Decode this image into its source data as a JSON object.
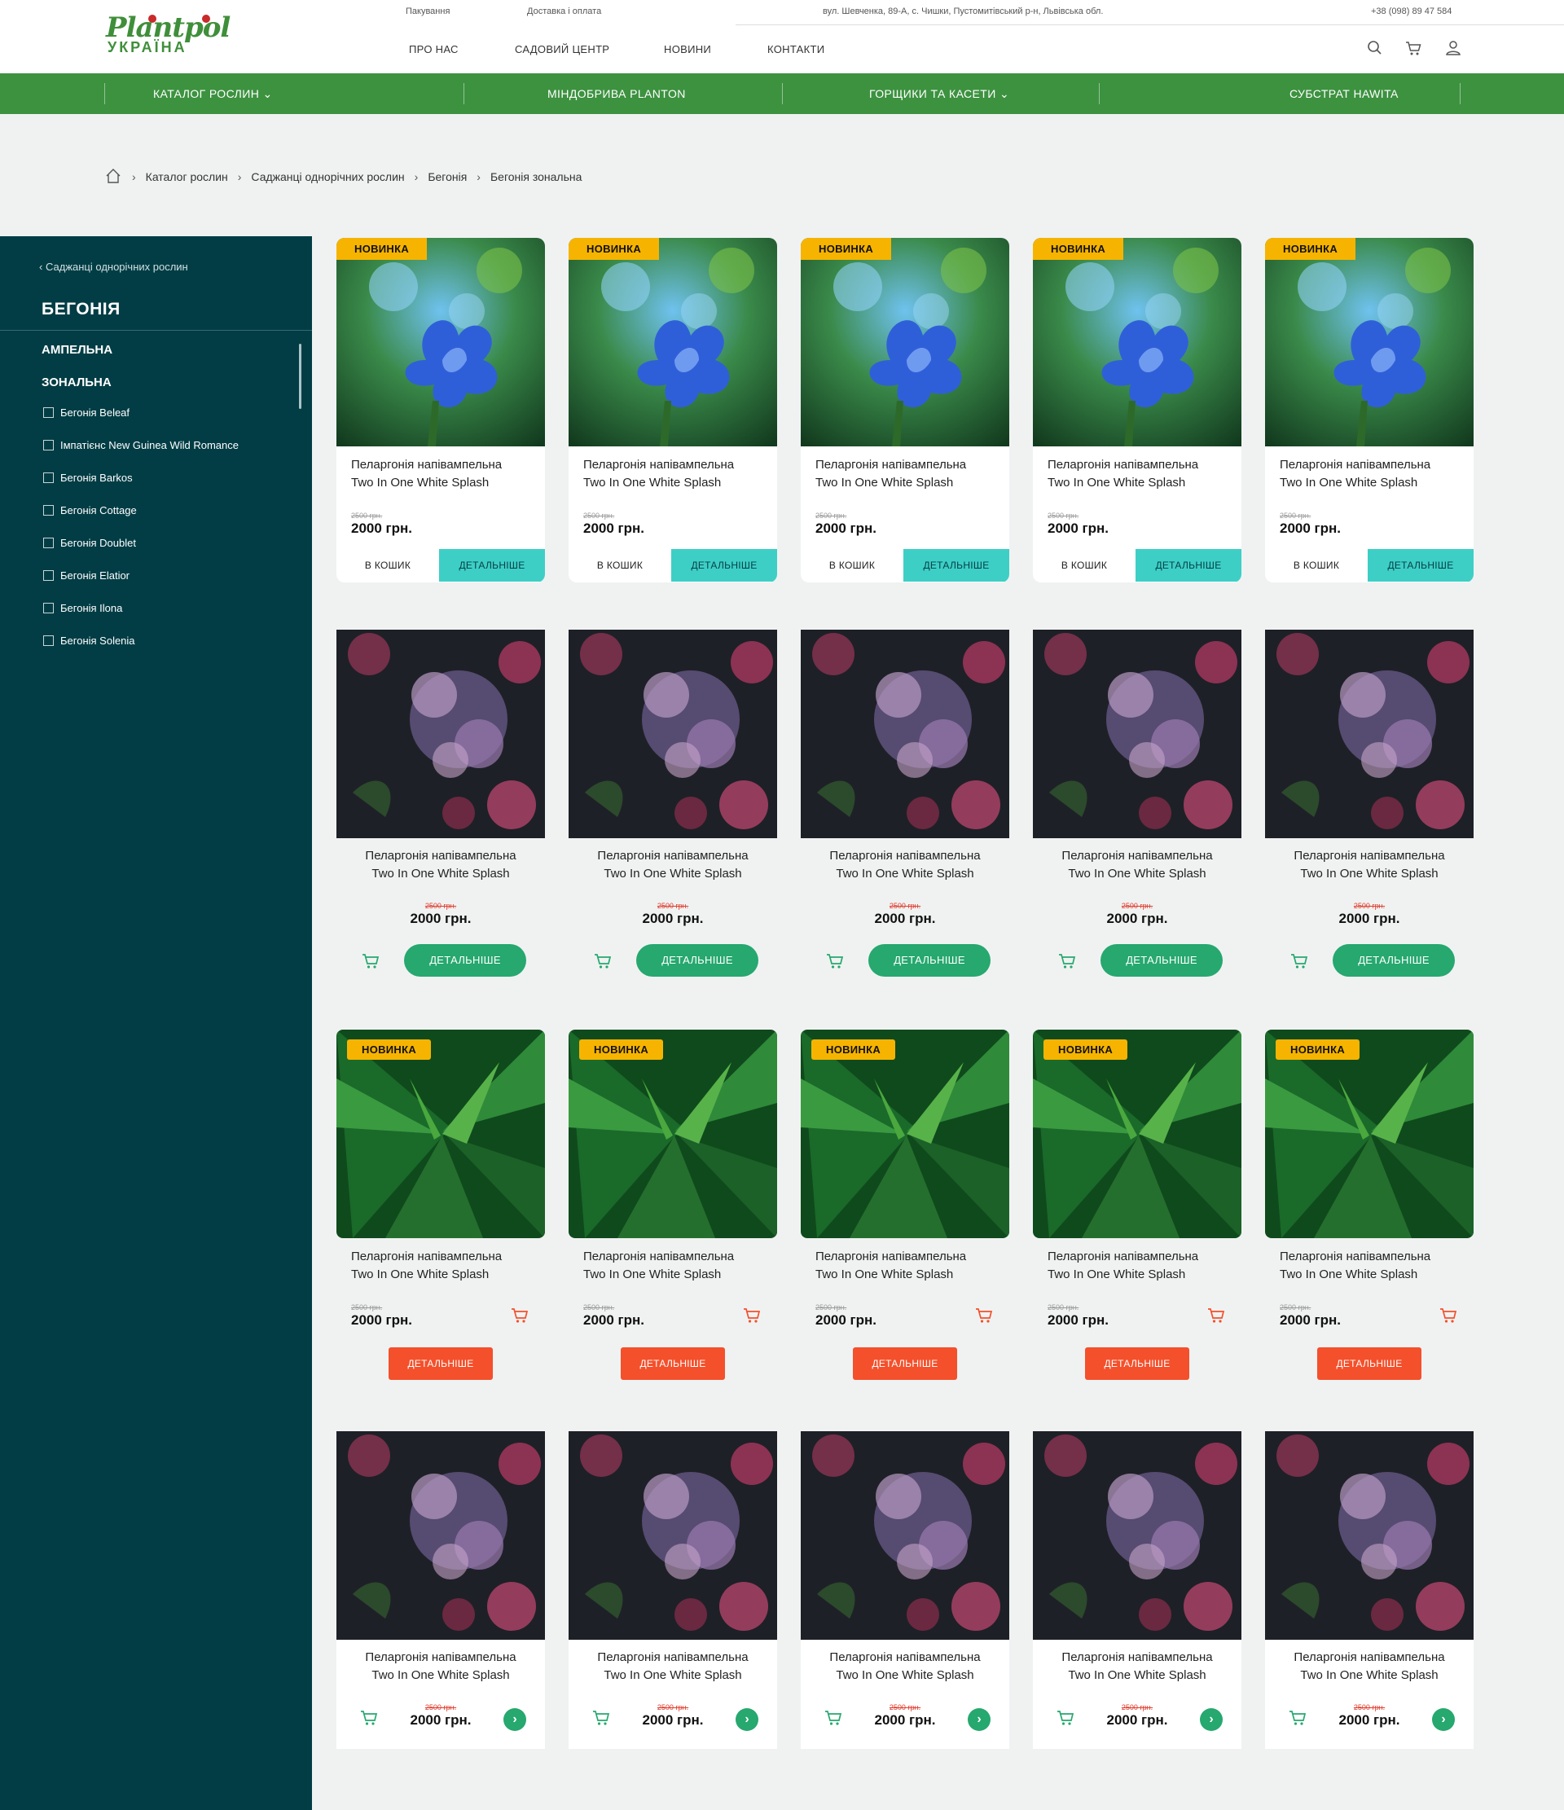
{
  "header": {
    "logo_top": "Plantpol",
    "logo_bottom": "УКРАЇНА",
    "top_links": [
      "Пакування",
      "Доставка і оплата"
    ],
    "address": "вул. Шевченка, 89-А, с. Чишки, Пустомитівський р-н, Львівська обл.",
    "phone": "+38 (098) 89 47 584",
    "main_links": [
      "ПРО НАС",
      "САДОВИЙ ЦЕНТР",
      "НОВИНИ",
      "КОНТАКТИ"
    ],
    "icons": [
      "search-icon",
      "cart-icon",
      "user-icon"
    ]
  },
  "greenbar": {
    "items": [
      "КАТАЛОГ РОСЛИН",
      "МІНДОБРИВА PLANTON",
      "ГОРЩИКИ ТА КАСЕТИ",
      "СУБСТРАТ HAWITA"
    ],
    "color": "#3d9240"
  },
  "breadcrumb": [
    "Каталог рослин",
    "Саджанці однорічних рослин",
    "Бегонія",
    "Бегонія зональна"
  ],
  "sidebar": {
    "back": "Саджанці однорічних рослин",
    "title": "БЕГОНІЯ",
    "sections": [
      "АМПЕЛЬНА",
      "ЗОНАЛЬНА"
    ],
    "items": [
      "Бегонія Beleaf",
      "Імпатієнс New Guinea Wild Romance",
      "Бегонія Barkos",
      "Бегонія Cottage",
      "Бегонія Doublet",
      "Бегонія Elatior",
      "Бегонія Ilona",
      "Бегонія Solenia"
    ],
    "color": "#023d45"
  },
  "product": {
    "badge": "НОВИНКА",
    "name_line1": "Пеларгонія напівампельна",
    "name_line2": "Two In One White Splash",
    "old_price": "2500 грн.",
    "price": "2000 грн.",
    "cart_label": "В КОШИК",
    "details_label": "ДЕТАЛЬНІШЕ",
    "arrow": "›"
  },
  "colors": {
    "accent_teal": "#3dcfc6",
    "accent_green": "#26a86f",
    "accent_orange": "#f4502b",
    "badge_yellow": "#f6b400"
  }
}
